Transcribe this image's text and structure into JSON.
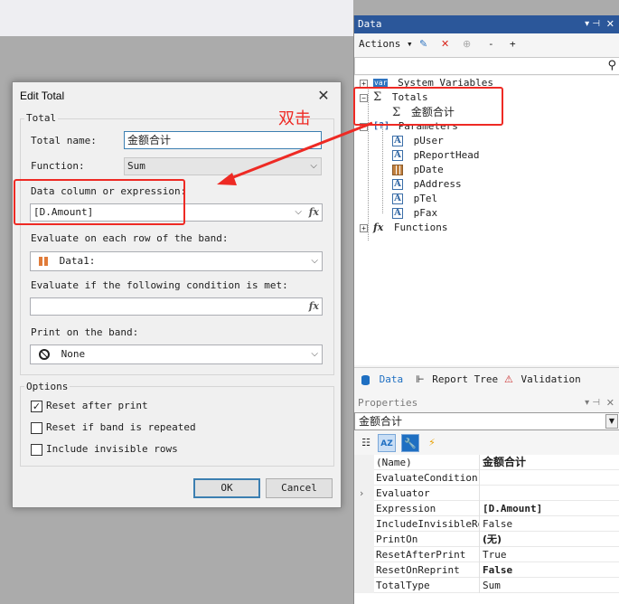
{
  "dialog": {
    "title": "Edit Total",
    "close_glyph": "✕",
    "total_group": "Total",
    "total_name_label": "Total name:",
    "total_name_value": "金额合计",
    "function_label": "Function:",
    "function_value": "Sum",
    "data_column_label": "Data column or expression:",
    "data_column_value": "[D.Amount]",
    "fx_label": "fx",
    "evaluate_each_label": "Evaluate on each row of the band:",
    "evaluate_each_value": "Data1:",
    "evaluate_if_label": "Evaluate if the following condition is met:",
    "evaluate_if_value": "",
    "print_on_label": "Print on the band:",
    "print_on_value": "None",
    "options_group": "Options",
    "options": [
      {
        "label": "Reset after print",
        "checked": true
      },
      {
        "label": "Reset if band is repeated",
        "checked": false
      },
      {
        "label": "Include invisible rows",
        "checked": false
      }
    ],
    "ok_label": "OK",
    "cancel_label": "Cancel"
  },
  "annotation": {
    "text": "双击",
    "color": "#ee2a24"
  },
  "data_panel": {
    "title": "Data",
    "actions_label": "Actions",
    "toolbar_minus": "-",
    "toolbar_plus": "+",
    "tree": {
      "system_variables": "System Variables",
      "var_badge": "var",
      "totals": "Totals",
      "total_item": "金额合计",
      "parameters": "Parameters",
      "params": [
        "pUser",
        "pReportHead",
        "pDate",
        "pAddress",
        "pTel",
        "pFax"
      ],
      "functions": "Functions"
    },
    "tabs": [
      "Data",
      "Report Tree",
      "Validation"
    ]
  },
  "properties_panel": {
    "title": "Properties",
    "selected_object": "金额合计",
    "rows": [
      {
        "name": "(Name)",
        "value": "金额合计",
        "bold": true
      },
      {
        "name": "EvaluateCondition",
        "value": "",
        "bold": false
      },
      {
        "name": "Evaluator",
        "value": "",
        "bold": false
      },
      {
        "name": "Expression",
        "value": "[D.Amount]",
        "bold": true
      },
      {
        "name": "IncludeInvisibleRows",
        "value": "False",
        "bold": false
      },
      {
        "name": "PrintOn",
        "value": "(无)",
        "bold": true
      },
      {
        "name": "ResetAfterPrint",
        "value": "True",
        "bold": false
      },
      {
        "name": "ResetOnReprint",
        "value": "False",
        "bold": true
      },
      {
        "name": "TotalType",
        "value": "Sum",
        "bold": false
      }
    ]
  },
  "colors": {
    "panel_header": "#2b579a",
    "accent": "#1e6fc2",
    "annotation_red": "#ee2a24"
  }
}
